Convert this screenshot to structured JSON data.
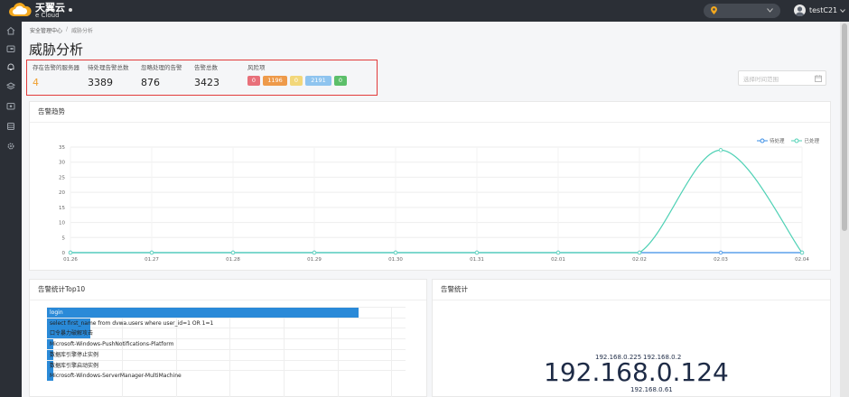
{
  "header": {
    "brand_name": "天翼云",
    "brand_sub": "e Cloud",
    "username": "testC21"
  },
  "sidebar": {
    "items": [
      {
        "icon": "home-icon"
      },
      {
        "icon": "asset-icon"
      },
      {
        "icon": "alert-bell-icon"
      },
      {
        "icon": "layers-icon"
      },
      {
        "icon": "monitor-icon"
      },
      {
        "icon": "database-icon"
      },
      {
        "icon": "settings-icon"
      }
    ]
  },
  "breadcrumb": {
    "parent": "安全管理中心",
    "separator": "/",
    "current": "威胁分析"
  },
  "page_title": "威胁分析",
  "stats": {
    "servers_label": "存在告警的服务器",
    "servers_value": "4",
    "pending_label": "待处理告警总数",
    "pending_value": "3389",
    "ignored_label": "忽略处理的告警",
    "ignored_value": "876",
    "total_label": "告警总数",
    "total_value": "3423",
    "risk_label": "风险项",
    "risk_badges": [
      {
        "value": "0",
        "color": "#e8707a"
      },
      {
        "value": "1196",
        "color": "#ee9a4a"
      },
      {
        "value": "0",
        "color": "#f2d77a"
      },
      {
        "value": "2191",
        "color": "#8ec4ef"
      },
      {
        "value": "0",
        "color": "#5cbf6a"
      }
    ]
  },
  "date_filter": {
    "placeholder": "选择时间范围"
  },
  "trend": {
    "title": "告警趋势",
    "legend": {
      "pending": "待处理",
      "handled": "已处理"
    }
  },
  "chart_data": [
    {
      "type": "line",
      "title": "告警趋势",
      "x": [
        "01.26",
        "01.27",
        "01.28",
        "01.29",
        "01.30",
        "01.31",
        "02.01",
        "02.02",
        "02.03",
        "02.04"
      ],
      "series": [
        {
          "name": "待处理",
          "color": "#3a8ee6",
          "values": [
            0,
            0,
            0,
            0,
            0,
            0,
            0,
            0,
            0,
            0
          ]
        },
        {
          "name": "已处理",
          "color": "#4fd1b5",
          "values": [
            0,
            0,
            0,
            0,
            0,
            0,
            0,
            0,
            34,
            0
          ]
        }
      ],
      "yticks": [
        "0",
        "5",
        "10",
        "15",
        "20",
        "25",
        "30",
        "35"
      ],
      "ylim": [
        0,
        35
      ],
      "grid": true,
      "legend_position": "top-right"
    },
    {
      "type": "bar",
      "title": "告警统计Top10",
      "orientation": "horizontal",
      "categories": [
        "login",
        "select first_name from dvwa.users where user_id=1 OR 1=1",
        "口令暴力破解攻击",
        "Microsoft-Windows-PushNotifications-Platform",
        "数据库引擎停止实例",
        "数据库引擎启动实例",
        "Microsoft-Windows-ServerManager-MultiMachine"
      ],
      "values": [
        1000,
        140,
        140,
        20,
        20,
        20,
        20
      ],
      "xlim": [
        0,
        1150
      ]
    }
  ],
  "top10": {
    "title": "告警统计Top10"
  },
  "cloud": {
    "title": "告警统计",
    "ips": [
      "192.168.0.225",
      "192.168.0.2",
      "192.168.0.124",
      "192.168.0.61"
    ],
    "ip_weights": [
      2,
      2,
      10,
      1
    ]
  }
}
